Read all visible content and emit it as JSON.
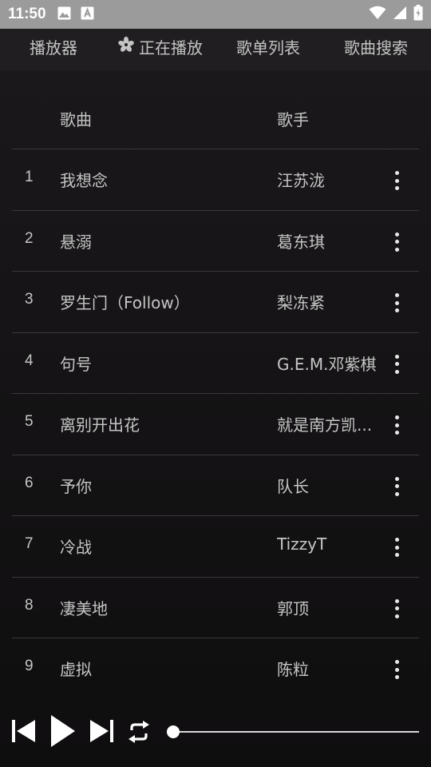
{
  "status_bar": {
    "time": "11:50",
    "notification_icons": [
      "image-icon",
      "a-letter-icon"
    ],
    "right_icons": [
      "wifi-icon",
      "signal-icon",
      "battery-icon"
    ]
  },
  "tabs": [
    {
      "label": "播放器"
    },
    {
      "label": "正在播放",
      "icon": "flower-icon",
      "active": true
    },
    {
      "label": "歌单列表"
    },
    {
      "label": "歌曲搜索"
    }
  ],
  "list": {
    "header": {
      "song": "歌曲",
      "artist": "歌手"
    },
    "rows": [
      {
        "num": "1",
        "song": "我想念",
        "artist": "汪苏泷"
      },
      {
        "num": "2",
        "song": "悬溺",
        "artist": "葛东琪"
      },
      {
        "num": "3",
        "song": "罗生门（Follow）",
        "artist": "梨冻紧"
      },
      {
        "num": "4",
        "song": "句号",
        "artist": "G.E.M.邓紫棋"
      },
      {
        "num": "5",
        "song": "离别开出花",
        "artist": "就是南方凯..."
      },
      {
        "num": "6",
        "song": "予你",
        "artist": "队长"
      },
      {
        "num": "7",
        "song": "冷战",
        "artist": "TizzyT"
      },
      {
        "num": "8",
        "song": "凄美地",
        "artist": "郭顶"
      },
      {
        "num": "9",
        "song": "虚拟",
        "artist": "陈粒"
      }
    ]
  },
  "player": {
    "controls": [
      "skip-previous-icon",
      "play-icon",
      "skip-next-icon",
      "repeat-icon"
    ],
    "progress": 0
  },
  "colors": {
    "status_bar_bg": "#9b9b9b",
    "tab_bar_bg": "#201e20",
    "text": "#c6c6c6",
    "divider": "#3a383a",
    "player_controls": "#ffffff"
  }
}
